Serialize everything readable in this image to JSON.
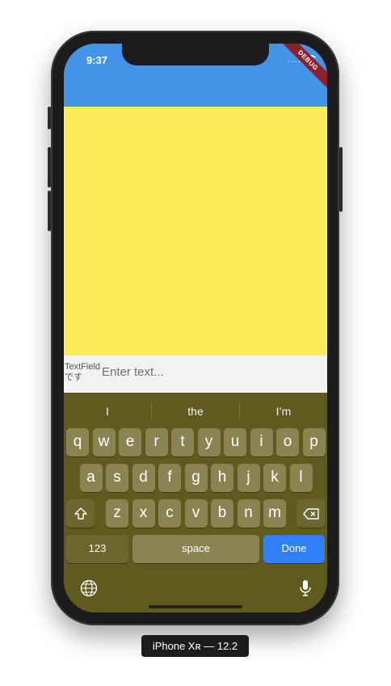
{
  "status_bar": {
    "time": "9:37",
    "signal": "....",
    "wifi_icon": "wifi-icon"
  },
  "debug_banner": "DEBUG",
  "textfield": {
    "label": "TextField です",
    "placeholder": "Enter text..."
  },
  "keyboard": {
    "suggestions": [
      "I",
      "the",
      "I’m"
    ],
    "row1": [
      "q",
      "w",
      "e",
      "r",
      "t",
      "y",
      "u",
      "i",
      "o",
      "p"
    ],
    "row2": [
      "a",
      "s",
      "d",
      "f",
      "g",
      "h",
      "j",
      "k",
      "l"
    ],
    "row3": [
      "z",
      "x",
      "c",
      "v",
      "b",
      "n",
      "m"
    ],
    "numbers_label": "123",
    "space_label": "space",
    "done_label": "Done",
    "colors": {
      "background": "#5f5a1d",
      "key": "#8a8452",
      "done": "#2f7ff6"
    }
  },
  "device_label": "iPhone Xʀ — 12.2",
  "colors": {
    "appbar": "#4493e9",
    "body": "#ffeb5a",
    "input_bg": "#f2f2f2"
  }
}
